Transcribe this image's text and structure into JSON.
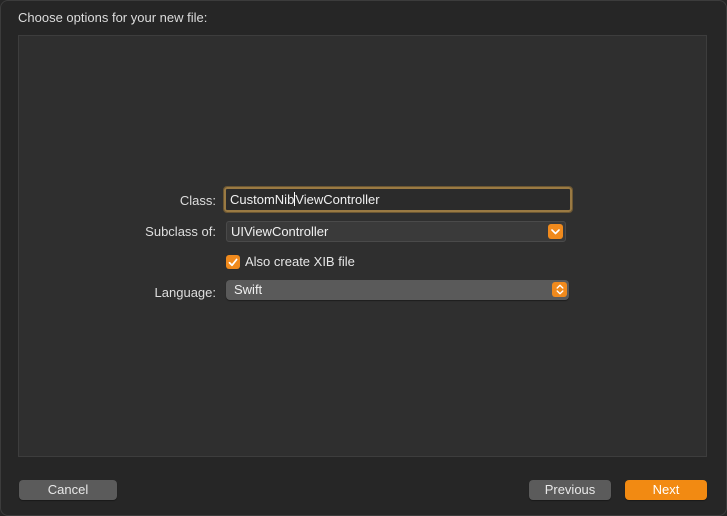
{
  "sheet": {
    "title": "Choose options for your new file:"
  },
  "form": {
    "class_label": "Class:",
    "class_value_before_cursor": "CustomNib",
    "class_value_after_cursor": "ViewController",
    "subclass_label": "Subclass of:",
    "subclass_value": "UIViewController",
    "xib_checkbox_label": "Also create XIB file",
    "xib_checked": true,
    "language_label": "Language:",
    "language_value": "Swift"
  },
  "buttons": {
    "cancel": "Cancel",
    "previous": "Previous",
    "next": "Next"
  },
  "colors": {
    "accent": "#f08a1d",
    "focus_ring": "#9a7a43",
    "background": "#262626",
    "panel": "#2f2f2f"
  },
  "icons": {
    "subclass_dropdown": "chevron-down-icon",
    "language_popup": "up-down-chevrons-icon",
    "checkbox": "checkmark-icon"
  }
}
